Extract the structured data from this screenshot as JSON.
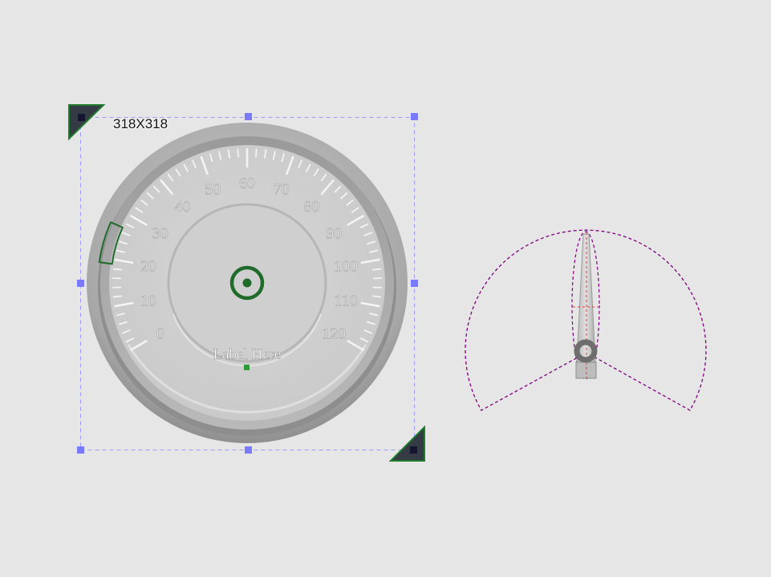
{
  "canvas": {
    "background": "#e6e6e6"
  },
  "selection": {
    "size_label": "318X318",
    "handle_color": "#7a7aff",
    "corner_color": "#1f7a2e"
  },
  "gauge": {
    "tick_labels": [
      "0",
      "10",
      "20",
      "30",
      "40",
      "50",
      "60",
      "70",
      "80",
      "90",
      "100",
      "110",
      "120"
    ],
    "range": [
      0,
      120
    ],
    "label": "Label Here",
    "needle_value": 20,
    "accent_color": "#1e6b2a"
  },
  "needle_preview": {
    "guide_color": "#800080"
  }
}
